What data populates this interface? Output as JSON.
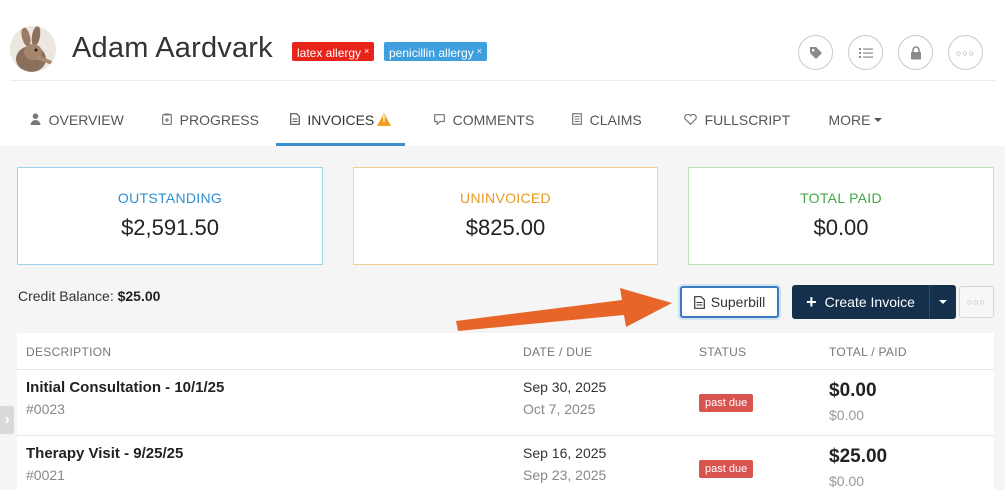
{
  "patient": {
    "name": "Adam Aardvark",
    "tags": [
      {
        "label": "latex allergy",
        "remove": "×",
        "color": "#e8241a"
      },
      {
        "label": "penicillin allergy",
        "remove": "×",
        "color": "#3f9fde"
      }
    ]
  },
  "header_actions": {
    "tag": "tag-icon",
    "checklist": "checklist-icon",
    "lock": "lock-icon",
    "more": "○○○"
  },
  "tabs": [
    {
      "label": "OVERVIEW",
      "icon": "user-icon"
    },
    {
      "label": "PROGRESS",
      "icon": "clipboard-icon"
    },
    {
      "label": "INVOICES",
      "icon": "document-icon",
      "active": true,
      "warning": true
    },
    {
      "label": "COMMENTS",
      "icon": "comment-icon"
    },
    {
      "label": "CLAIMS",
      "icon": "claims-icon"
    },
    {
      "label": "FULLSCRIPT",
      "icon": "heart-icon"
    },
    {
      "label": "MORE",
      "icon": "caret-down-icon"
    }
  ],
  "summary": {
    "outstanding": {
      "label": "OUTSTANDING",
      "value": "$2,591.50",
      "color": "#2f8fd0"
    },
    "uninvoiced": {
      "label": "UNINVOICED",
      "value": "$825.00",
      "color": "#e89a22"
    },
    "total_paid": {
      "label": "TOTAL PAID",
      "value": "$0.00",
      "color": "#43a848"
    }
  },
  "credit": {
    "label": "Credit Balance:",
    "value": "$25.00"
  },
  "actions": {
    "superbill": "Superbill",
    "create_invoice": "Create Invoice",
    "more": "○○○"
  },
  "table": {
    "headers": [
      "DESCRIPTION",
      "DATE / DUE",
      "STATUS",
      "TOTAL / PAID"
    ],
    "rows": [
      {
        "description": "Initial Consultation - 10/1/25",
        "number": "#0023",
        "date": "Sep 30, 2025",
        "due": "Oct 7, 2025",
        "status": "past due",
        "total": "$0.00",
        "paid": "$0.00"
      },
      {
        "description": "Therapy Visit - 9/25/25",
        "number": "#0021",
        "date": "Sep 16, 2025",
        "due": "Sep 23, 2025",
        "status": "past due",
        "total": "$25.00",
        "paid": "$0.00"
      }
    ]
  },
  "colors": {
    "accent": "#3a8fcf",
    "primary_button": "#15304c",
    "past_due": "#d9534f",
    "arrow": "#e8652a"
  }
}
